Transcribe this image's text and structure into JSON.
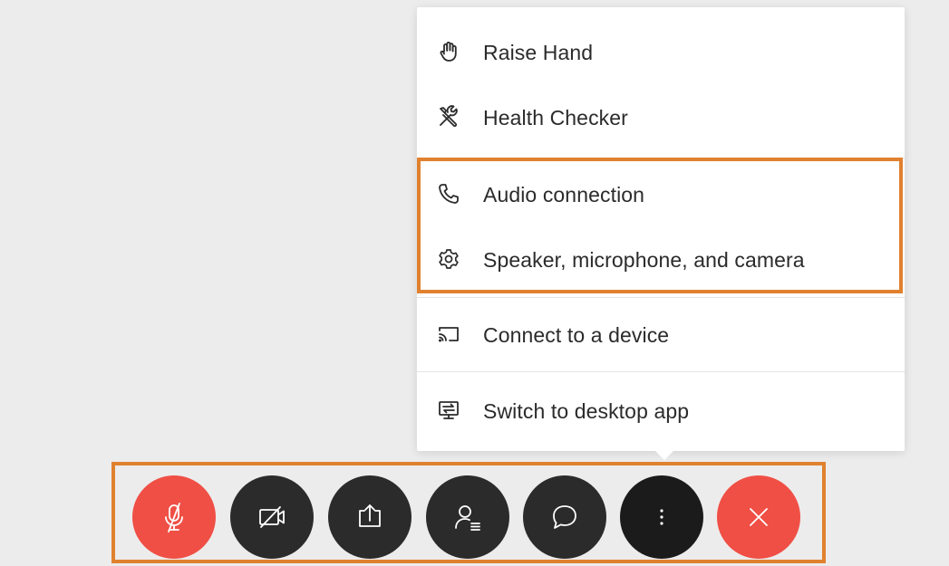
{
  "menu": {
    "items": [
      {
        "label": "Raise Hand",
        "icon": "raise-hand-icon"
      },
      {
        "label": "Health Checker",
        "icon": "tools-icon"
      },
      {
        "label": "Audio connection",
        "icon": "phone-icon"
      },
      {
        "label": "Speaker, microphone, and camera",
        "icon": "gear-icon"
      },
      {
        "label": "Connect to a device",
        "icon": "cast-icon"
      },
      {
        "label": "Switch to desktop app",
        "icon": "desktop-switch-icon"
      }
    ]
  },
  "toolbar": {
    "buttons": [
      {
        "name": "mute",
        "icon": "microphone-muted-icon",
        "color": "#f04f45"
      },
      {
        "name": "video",
        "icon": "camera-off-icon",
        "color": "#2b2b2b"
      },
      {
        "name": "share",
        "icon": "share-icon",
        "color": "#2b2b2b"
      },
      {
        "name": "participants",
        "icon": "participants-icon",
        "color": "#2b2b2b"
      },
      {
        "name": "chat",
        "icon": "chat-icon",
        "color": "#2b2b2b"
      },
      {
        "name": "more",
        "icon": "more-vertical-icon",
        "color": "#1b1b1b"
      },
      {
        "name": "leave",
        "icon": "close-icon",
        "color": "#f04f45"
      }
    ]
  },
  "colors": {
    "highlight": "#e0812f",
    "danger": "#f04f45",
    "button_dark": "#2b2b2b",
    "background": "#ececec"
  }
}
